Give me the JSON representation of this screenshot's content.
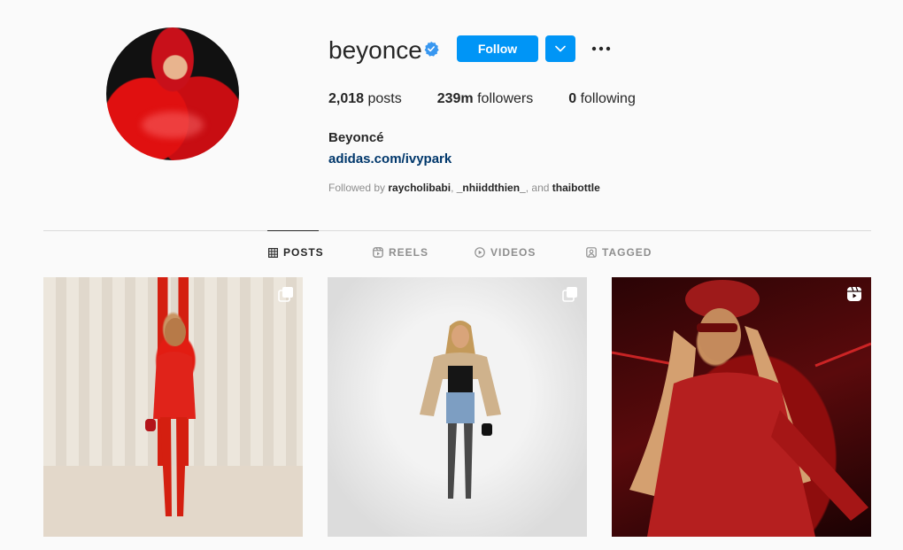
{
  "profile": {
    "username": "beyonce",
    "full_name": "Beyoncé",
    "link": "adidas.com/ivypark",
    "follow_label": "Follow",
    "followed_by_prefix": "Followed by ",
    "followed_by_users": [
      "raycholibabi",
      "_nhiiddthien_",
      "thaibottle"
    ],
    "followed_by_sep1": ", ",
    "followed_by_sep2": ", and "
  },
  "stats": {
    "posts_value": "2,018",
    "posts_label": " posts",
    "followers_value": "239m",
    "followers_label": " followers",
    "following_value": "0",
    "following_label": " following"
  },
  "tabs": [
    {
      "label": "POSTS",
      "icon": "grid-icon",
      "active": true
    },
    {
      "label": "REELS",
      "icon": "reels-icon",
      "active": false
    },
    {
      "label": "VIDEOS",
      "icon": "play-icon",
      "active": false
    },
    {
      "label": "TAGGED",
      "icon": "tag-icon",
      "active": false
    }
  ],
  "posts": [
    {
      "type": "carousel",
      "icon": "carousel-icon"
    },
    {
      "type": "carousel",
      "icon": "carousel-icon"
    },
    {
      "type": "reel",
      "icon": "reel-icon"
    }
  ],
  "colors": {
    "accent": "#0095f6",
    "link": "#00376b",
    "verified": "#3897f0",
    "muted": "#8e8e8e"
  }
}
